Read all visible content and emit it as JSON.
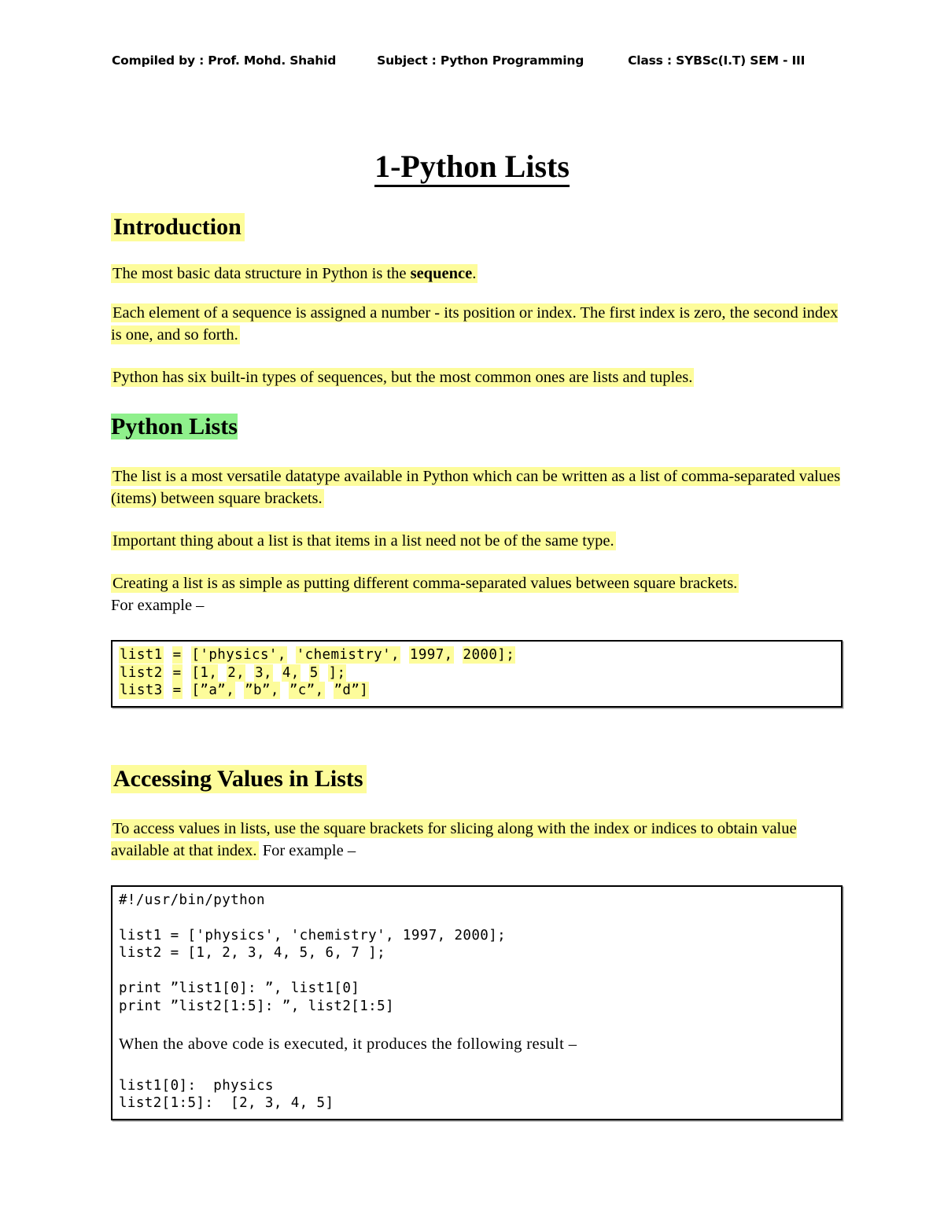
{
  "header": {
    "compiled_by": "Compiled by : Prof. Mohd. Shahid",
    "subject": "Subject : Python Programming",
    "class": "Class : SYBSc(I.T) SEM - III"
  },
  "title": "1-Python Lists",
  "colors": {
    "highlight_yellow": "#fdfc9b",
    "highlight_green": "#8ff08c",
    "text": "#000000",
    "page_background": "#ffffff",
    "code_border": "#000000"
  },
  "sections": {
    "introduction": {
      "heading": "Introduction",
      "para1_a": "The most basic data structure in Python is the ",
      "para1_b": "sequence",
      "para1_c": ".",
      "para2": "Each element of a sequence is assigned a number - its position or index. The first index is zero, the second index is one, and so forth.",
      "para3": "Python has six built-in types of sequences, but the most common ones are lists and tuples."
    },
    "python_lists": {
      "heading": "Python Lists",
      "para1": "The list is a most versatile datatype available in Python which can be written as a list of comma-separated values (items) between square brackets.",
      "para2": " Important thing about a list is that items in a list need not be of the same type.",
      "para3_highlighted": "Creating a list is as simple as putting different comma-separated values between square brackets.",
      "para3_plain": "For example –",
      "code_block": {
        "line1_tokens": [
          "list1",
          "=",
          "['physics',",
          "'chemistry',",
          "1997,",
          "2000];"
        ],
        "line2_tokens": [
          "list2",
          "=",
          "[1,",
          "2,",
          "3,",
          "4,",
          "5",
          "];"
        ],
        "line3_tokens": [
          "list3",
          "=",
          "[”a”,",
          "”b”,",
          "”c”,",
          "”d”]"
        ],
        "line1_plain": "list1 = ['physics', 'chemistry', 1997, 2000];",
        "line2_plain": "list2 = [1, 2, 3, 4, 5 ];",
        "line3_plain": "list3 = [”a”, ”b”, ”c”, ”d”]"
      }
    },
    "accessing_values": {
      "heading": "Accessing Values in Lists",
      "para1_highlighted": "To access values in lists, use the square brackets for slicing along with the index or indices to obtain value available at that index.",
      "para1_plain": " For example –",
      "code_block": {
        "shebang": "#!/usr/bin/python",
        "list1": "list1 = ['physics', 'chemistry', 1997, 2000];",
        "list2": "list2 = [1, 2, 3, 4, 5, 6, 7 ];",
        "print1": "print ”list1[0]: ”, list1[0]",
        "print2": "print ”list2[1:5]: ”, list2[1:5]",
        "prose": "When the above code is executed, it produces the following result –",
        "out1": "list1[0]:  physics",
        "out2": "list2[1:5]:  [2, 3, 4, 5]"
      }
    }
  }
}
